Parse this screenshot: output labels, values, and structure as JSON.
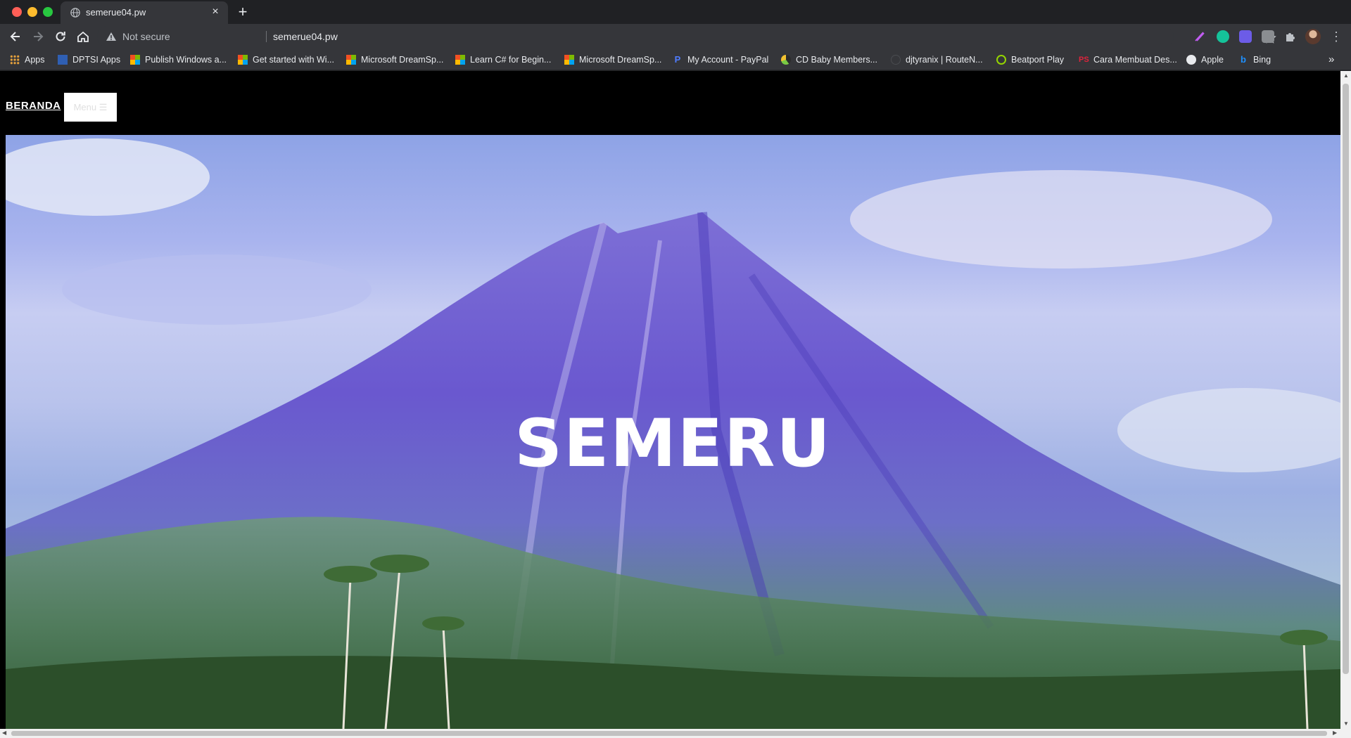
{
  "browser": {
    "tab": {
      "title": "semerue04.pw"
    },
    "address": {
      "security_label": "Not secure",
      "url": "semerue04.pw"
    },
    "bookmarks": [
      {
        "label": "Apps",
        "icon": "apps-grid-icon"
      },
      {
        "label": "DPTSI Apps",
        "icon": "dptsi-icon"
      },
      {
        "label": "Publish Windows a...",
        "icon": "microsoft-icon"
      },
      {
        "label": "Get started with Wi...",
        "icon": "microsoft-icon"
      },
      {
        "label": "Microsoft DreamSp...",
        "icon": "microsoft-icon"
      },
      {
        "label": "Learn C# for Begin...",
        "icon": "microsoft-icon"
      },
      {
        "label": "Microsoft DreamSp...",
        "icon": "microsoft-icon"
      },
      {
        "label": "My Account - PayPal",
        "icon": "paypal-icon"
      },
      {
        "label": "CD Baby Members...",
        "icon": "cdbaby-icon"
      },
      {
        "label": "djtyranix | RouteN...",
        "icon": "routenote-icon"
      },
      {
        "label": "Beatport Play",
        "icon": "beatport-icon"
      },
      {
        "label": "Cara Membuat Des...",
        "icon": "photoshop-icon"
      },
      {
        "label": "Apple",
        "icon": "globe-icon"
      },
      {
        "label": "Bing",
        "icon": "bing-icon"
      }
    ],
    "more_bookmarks": "»"
  },
  "site": {
    "nav": {
      "home_label": "BERANDA",
      "menu_label": "Menu ☰"
    },
    "hero": {
      "title": "SEMERU"
    }
  }
}
